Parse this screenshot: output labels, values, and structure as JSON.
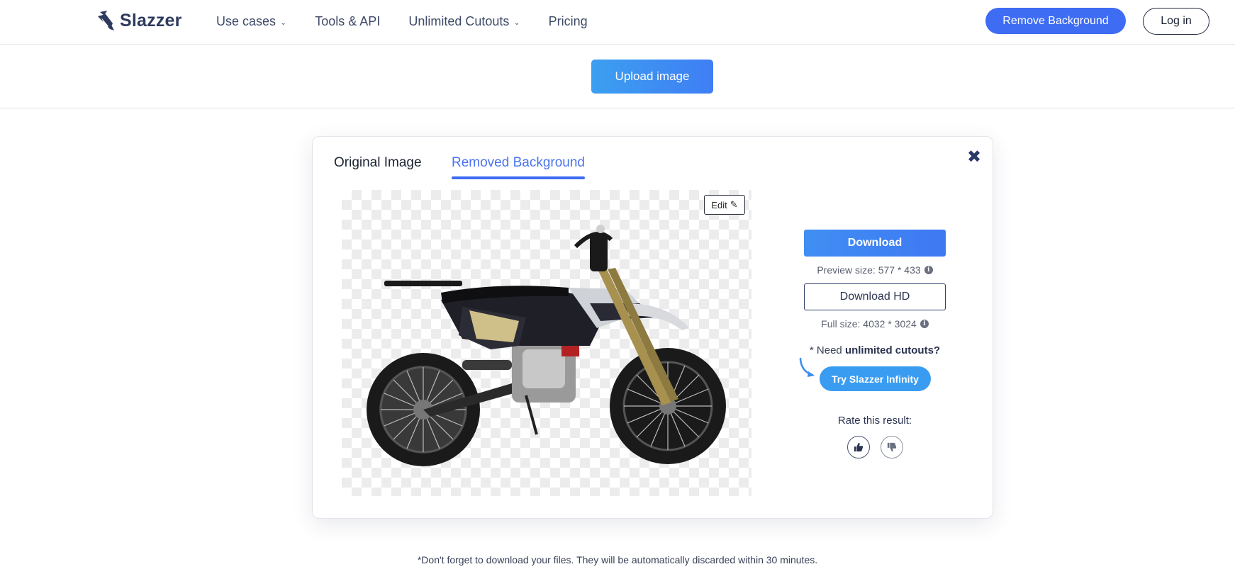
{
  "header": {
    "logo_text": "Slazzer",
    "nav": [
      {
        "label": "Use cases",
        "has_dropdown": true
      },
      {
        "label": "Tools & API",
        "has_dropdown": false
      },
      {
        "label": "Unlimited Cutouts",
        "has_dropdown": true
      },
      {
        "label": "Pricing",
        "has_dropdown": false
      }
    ],
    "remove_bg_label": "Remove Background",
    "login_label": "Log in"
  },
  "upload": {
    "label": "Upload image"
  },
  "card": {
    "tabs": [
      {
        "label": "Original Image",
        "active": false
      },
      {
        "label": "Removed Background",
        "active": true
      }
    ],
    "close_icon": "close-icon",
    "edit_label": "Edit",
    "download_label": "Download",
    "preview_size": "Preview size: 577 * 433",
    "download_hd_label": "Download HD",
    "full_size": "Full size: 4032 * 3024",
    "need_prefix": "* Need",
    "need_bold": "unlimited cutouts?",
    "infinity_label": "Try Slazzer Infinity",
    "rate_label": "Rate this result:"
  },
  "footnote": "*Don't forget to download your files. They will be automatically discarded within 30 minutes.",
  "colors": {
    "accent": "#3e6cf3",
    "upload_gradient_start": "#3c9ff0",
    "infinity": "#3a9cf0",
    "text_dark": "#2b3450"
  }
}
